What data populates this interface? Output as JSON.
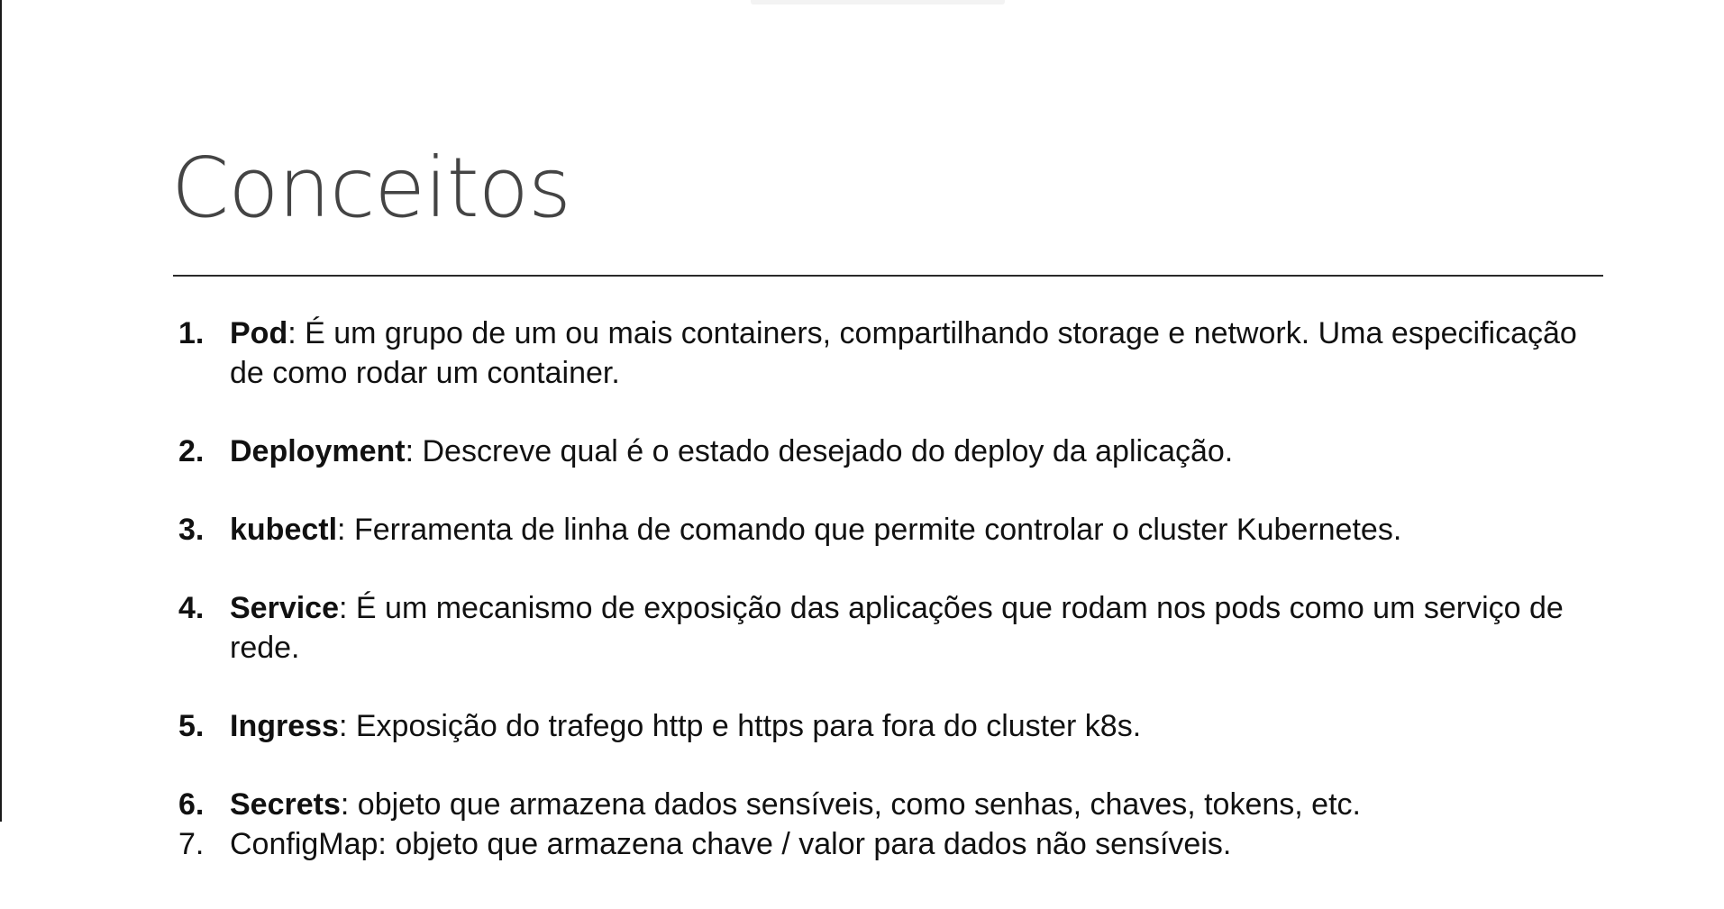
{
  "slide": {
    "title": "Conceitos"
  },
  "concepts": [
    {
      "number": "1.",
      "term": "Pod",
      "sep": ": ",
      "description": "É um grupo de um ou mais containers, compartilhando storage e network. Uma especificação de como rodar um container."
    },
    {
      "number": "2.",
      "term": "Deployment",
      "sep": ": ",
      "description": "Descreve qual é o estado desejado do deploy da aplicação."
    },
    {
      "number": "3.",
      "term": "kubectl",
      "sep": ": ",
      "description": "Ferramenta de linha de comando que permite controlar o cluster Kubernetes."
    },
    {
      "number": "4.",
      "term": "Service",
      "sep": ": ",
      "description": "É um mecanismo de exposição das aplicações que rodam nos pods como um serviço de rede."
    },
    {
      "number": "5.",
      "term": "Ingress",
      "sep": ": ",
      "description": "Exposição do trafego http e https para fora do cluster k8s."
    },
    {
      "number": "6.",
      "term": "Secrets",
      "sep": ": ",
      "description": "objeto que armazena dados sensíveis, como senhas, chaves, tokens, etc."
    },
    {
      "number": "7.",
      "text": "ConfigMap: objeto que armazena chave / valor para dados não sensíveis."
    }
  ]
}
